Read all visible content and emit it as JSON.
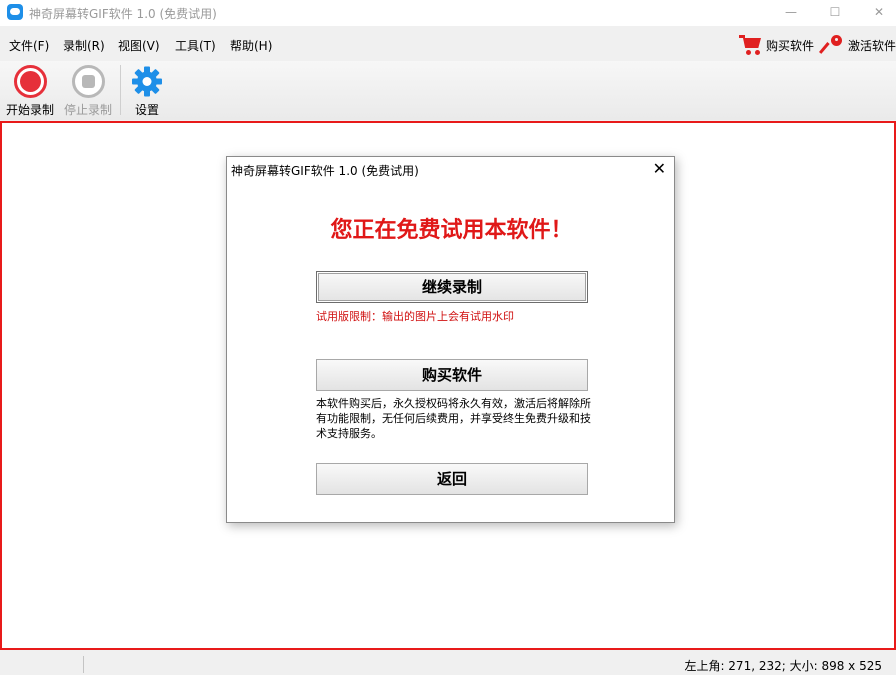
{
  "window": {
    "title": "神奇屏幕转GIF软件 1.0 (免费试用)",
    "minimize": "—",
    "maximize": "☐",
    "close": "✕"
  },
  "menu": {
    "items": [
      "文件(F)",
      "录制(R)",
      "视图(V)",
      "工具(T)",
      "帮助(H)"
    ],
    "buy": "购买软件",
    "activate": "激活软件"
  },
  "toolbar": {
    "start": "开始录制",
    "stop": "停止录制",
    "settings": "设置"
  },
  "status": {
    "position": "左上角: 271, 232; 大小: 898 x 525"
  },
  "dialog": {
    "title": "神奇屏幕转GIF软件 1.0 (免费试用)",
    "close": "✕",
    "headline": "您正在免费试用本软件！",
    "continue_button": "继续录制",
    "trial_note": "试用版限制：输出的图片上会有试用水印",
    "buy_button": "购买软件",
    "description": "本软件购买后，永久授权码将永久有效，激活后将解除所有功能限制，无任何后续费用，并享受终生免费升级和技术支持服务。",
    "back_button": "返回"
  },
  "colors": {
    "accent_red": "#e01818",
    "record_red": "#e6303a",
    "settings_blue": "#1e8fe8",
    "canvas_border": "#e81a1a"
  },
  "icons": {
    "app": "app-icon",
    "cart": "cart-icon",
    "key": "key-icon",
    "record": "record-icon",
    "stop": "stop-icon",
    "settings": "gear-icon"
  }
}
